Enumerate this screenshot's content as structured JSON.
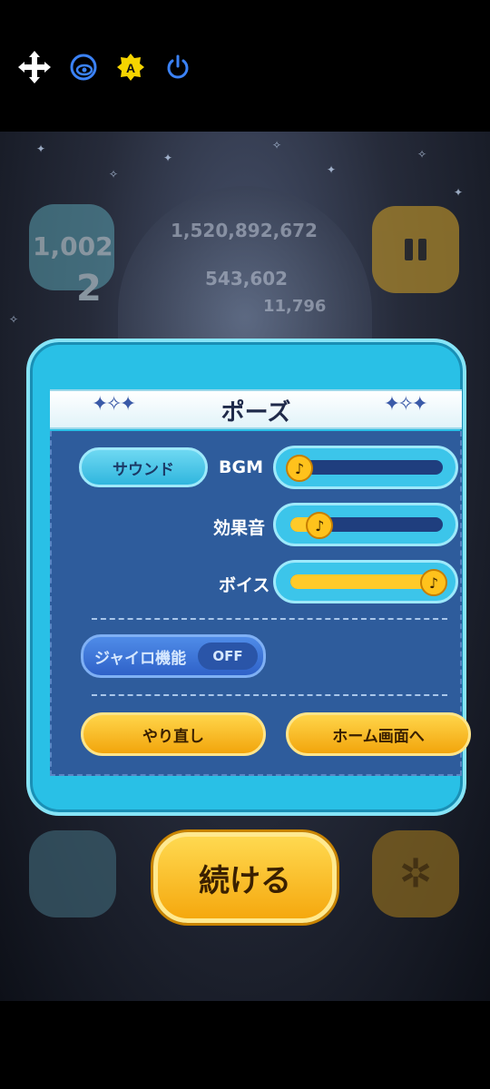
{
  "status_icons": [
    "move-arrows-icon",
    "eye-icon",
    "auto-brightness-icon",
    "power-icon"
  ],
  "background": {
    "total_score": "1,520,892,672",
    "score": "543,602",
    "combo": "11,796",
    "hud_left_number": "1,002",
    "hud_left_small": "2"
  },
  "dialog": {
    "title": "ポーズ",
    "sound_button": "サウンド",
    "bgm_label": "BGM",
    "sfx_label": "効果音",
    "voice_label": "ボイス",
    "bgm_level": 0.0,
    "sfx_level": 0.15,
    "voice_level": 1.0,
    "gyro_label": "ジャイロ機能",
    "gyro_state": "OFF",
    "retry_button": "やり直し",
    "home_button": "ホーム画面へ"
  },
  "continue_button": "続ける",
  "colors": {
    "dialog_frame": "#29c0e6",
    "dialog_body": "#2e5c9c",
    "yellow_button": "#ffc21c",
    "status_icon_blue": "#3b82f6",
    "status_icon_yellow": "#f5d400"
  }
}
